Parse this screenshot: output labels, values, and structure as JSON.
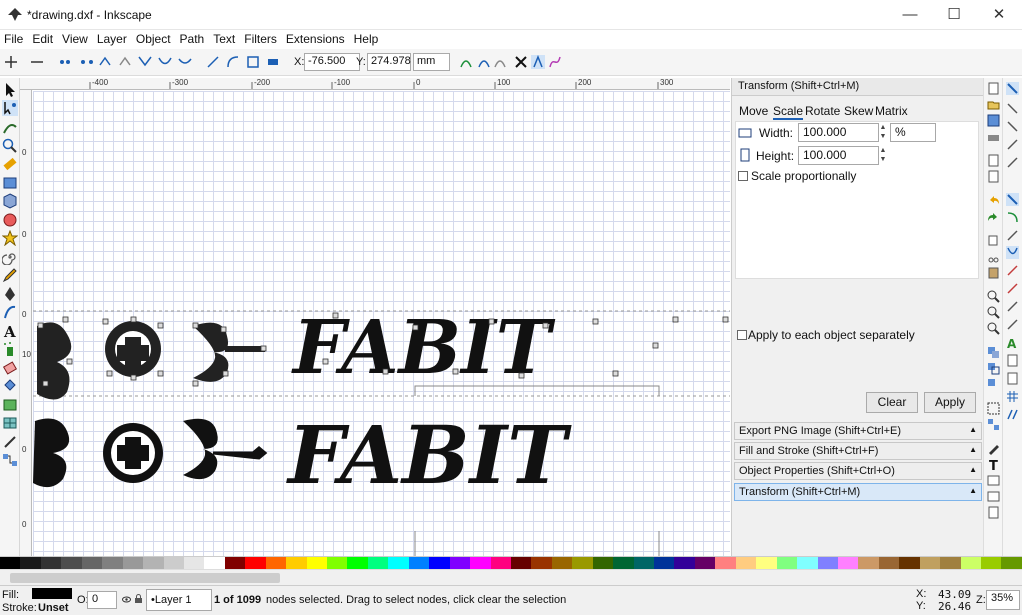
{
  "window": {
    "title": "*drawing.dxf - Inkscape",
    "minimize": "—",
    "maximize": "☐",
    "close": "✕"
  },
  "menu": [
    {
      "label": "File"
    },
    {
      "label": "Edit"
    },
    {
      "label": "View"
    },
    {
      "label": "Layer"
    },
    {
      "label": "Object"
    },
    {
      "label": "Path"
    },
    {
      "label": "Text"
    },
    {
      "label": "Filters"
    },
    {
      "label": "Extensions"
    },
    {
      "label": "Help"
    }
  ],
  "toolbar": {
    "x_label": "X:",
    "x_value": "-76.500",
    "y_label": "Y:",
    "y_value": "274.978",
    "unit": "mm"
  },
  "ruler": {
    "h_ticks": [
      "-400",
      "-300",
      "-200",
      "-100",
      "0",
      "100",
      "200",
      "300"
    ],
    "v_ticks": [
      "0",
      "0",
      "0",
      "100",
      "0",
      "0"
    ]
  },
  "canvas": {
    "selected_text": "FABIT",
    "normal_text": "FABIT"
  },
  "panel": {
    "title": "Transform (Shift+Ctrl+M)",
    "tabs": [
      "Move",
      "Scale",
      "Rotate",
      "Skew",
      "Matrix"
    ],
    "width_label": "Width:",
    "width_value": "100.000",
    "height_label": "Height:",
    "height_value": "100.000",
    "unit": "%",
    "scale_proportionally": "Scale proportionally",
    "apply_each": "Apply to each object separately",
    "clear": "Clear",
    "apply": "Apply",
    "docked": [
      "Export PNG Image (Shift+Ctrl+E)",
      "Fill and Stroke (Shift+Ctrl+F)",
      "Object Properties (Shift+Ctrl+O)",
      "Transform (Shift+Ctrl+M)"
    ]
  },
  "palette": [
    "#000000",
    "#1a1a1a",
    "#333333",
    "#4d4d4d",
    "#666666",
    "#808080",
    "#999999",
    "#b3b3b3",
    "#cccccc",
    "#e6e6e6",
    "#ffffff",
    "#800000",
    "#ff0000",
    "#ff6600",
    "#ffcc00",
    "#ffff00",
    "#80ff00",
    "#00ff00",
    "#00ff80",
    "#00ffff",
    "#0080ff",
    "#0000ff",
    "#8000ff",
    "#ff00ff",
    "#ff0080",
    "#660000",
    "#993300",
    "#996600",
    "#999900",
    "#336600",
    "#006633",
    "#006666",
    "#003399",
    "#330099",
    "#660066",
    "#ff8080",
    "#ffcc80",
    "#ffff80",
    "#80ff80",
    "#80ffff",
    "#8080ff",
    "#ff80ff",
    "#cc9966",
    "#996633",
    "#663300",
    "#c0a060",
    "#a08040",
    "#ccff66",
    "#99cc00",
    "#669900"
  ],
  "statusbar": {
    "fill_label": "Fill:",
    "stroke_label": "Stroke:",
    "stroke_value": "Unset",
    "opacity_label": "O:",
    "opacity_value": "0",
    "layer": "•Layer 1",
    "message_bold": "1 of 1099",
    "message": " nodes selected. Drag to select nodes, click clear the selection",
    "x_label": "X:",
    "x_value": "43.09",
    "y_label": "Y:",
    "y_value": "26.46",
    "zoom_label": "Z:",
    "zoom_value": "35%"
  }
}
